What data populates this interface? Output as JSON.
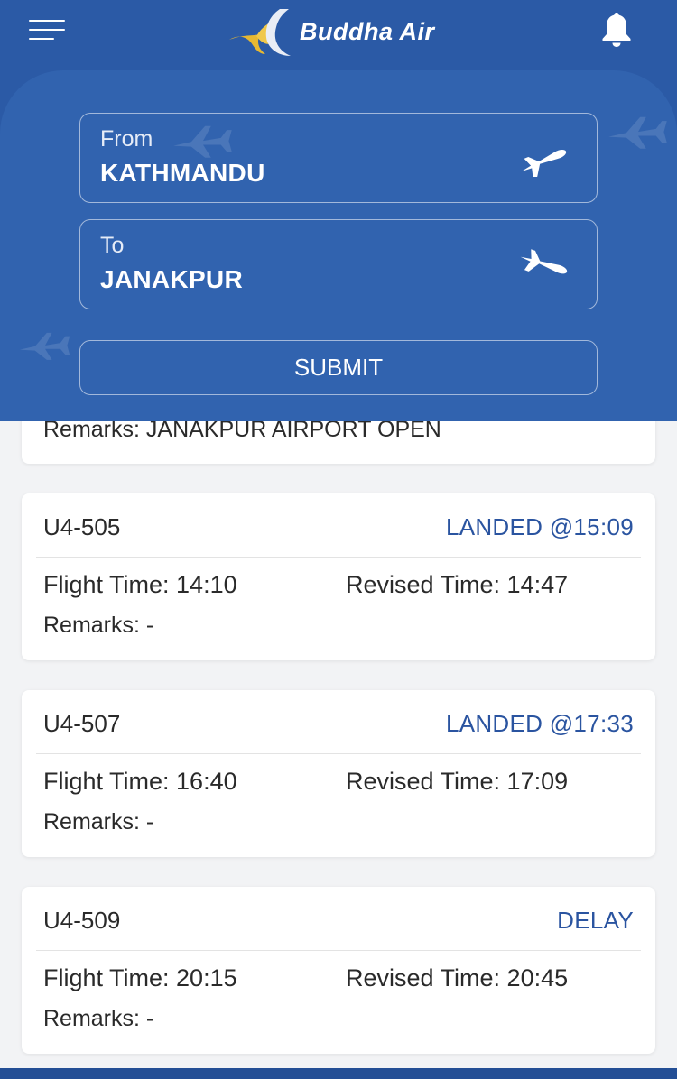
{
  "header": {
    "brand": "Buddha Air",
    "menu_icon": "hamburger-menu-icon",
    "notification_icon": "bell-icon",
    "colors": {
      "primary": "#2b5aa6",
      "panel": "#3163af",
      "status_text": "#2a54a0"
    }
  },
  "search": {
    "from_label": "From",
    "from_value": "KATHMANDU",
    "from_icon": "airplane-takeoff-icon",
    "to_label": "To",
    "to_value": "JANAKPUR",
    "to_icon": "airplane-landing-icon",
    "submit_label": "SUBMIT"
  },
  "partial_card": {
    "remarks": "Remarks: JANAKPUR AIRPORT  OPEN"
  },
  "flights": [
    {
      "flight_no": "U4-505",
      "status": "LANDED @15:09",
      "flight_time": "Flight Time: 14:10",
      "revised_time": "Revised Time: 14:47",
      "remarks": "Remarks: -"
    },
    {
      "flight_no": "U4-507",
      "status": "LANDED @17:33",
      "flight_time": "Flight Time: 16:40",
      "revised_time": "Revised Time: 17:09",
      "remarks": "Remarks: -"
    },
    {
      "flight_no": "U4-509",
      "status": "DELAY",
      "flight_time": "Flight Time: 20:15",
      "revised_time": "Revised Time: 20:45",
      "remarks": "Remarks: -"
    }
  ]
}
